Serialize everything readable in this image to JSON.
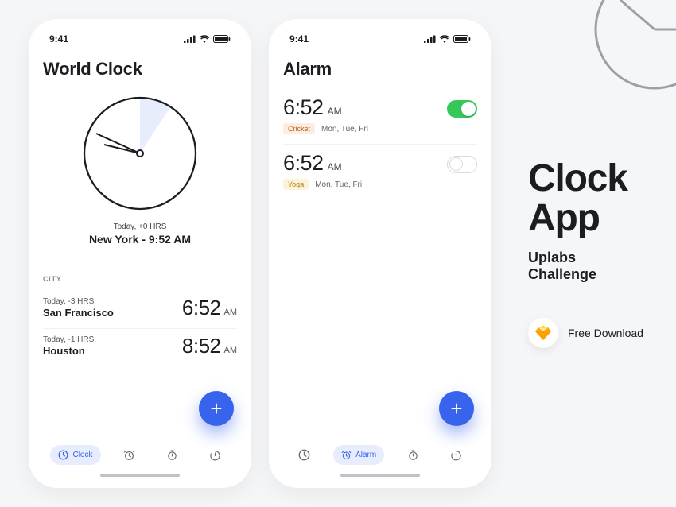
{
  "statusbar": {
    "time": "9:41"
  },
  "world_clock": {
    "title": "World Clock",
    "main": {
      "offset": "Today, +0 HRS",
      "city_time": "New York - 9:52 AM"
    },
    "city_header": "CITY",
    "cities": [
      {
        "offset": "Today, -3 HRS",
        "name": "San Francisco",
        "time": "6:52",
        "ampm": "AM"
      },
      {
        "offset": "Today, -1 HRS",
        "name": "Houston",
        "time": "8:52",
        "ampm": "AM"
      }
    ]
  },
  "alarm": {
    "title": "Alarm",
    "items": [
      {
        "time": "6:52",
        "ampm": "AM",
        "tag": "Cricket",
        "tag_class": "cricket",
        "days": "Mon, Tue, Fri",
        "on": true
      },
      {
        "time": "6:52",
        "ampm": "AM",
        "tag": "Yoga",
        "tag_class": "yoga",
        "days": "Mon, Tue, Fri",
        "on": false
      }
    ]
  },
  "tabs": {
    "clock": "Clock",
    "alarm": "Alarm"
  },
  "promo": {
    "heading1": "Clock",
    "heading2": "App",
    "sub": "Uplabs Challenge",
    "download": "Free Download"
  }
}
